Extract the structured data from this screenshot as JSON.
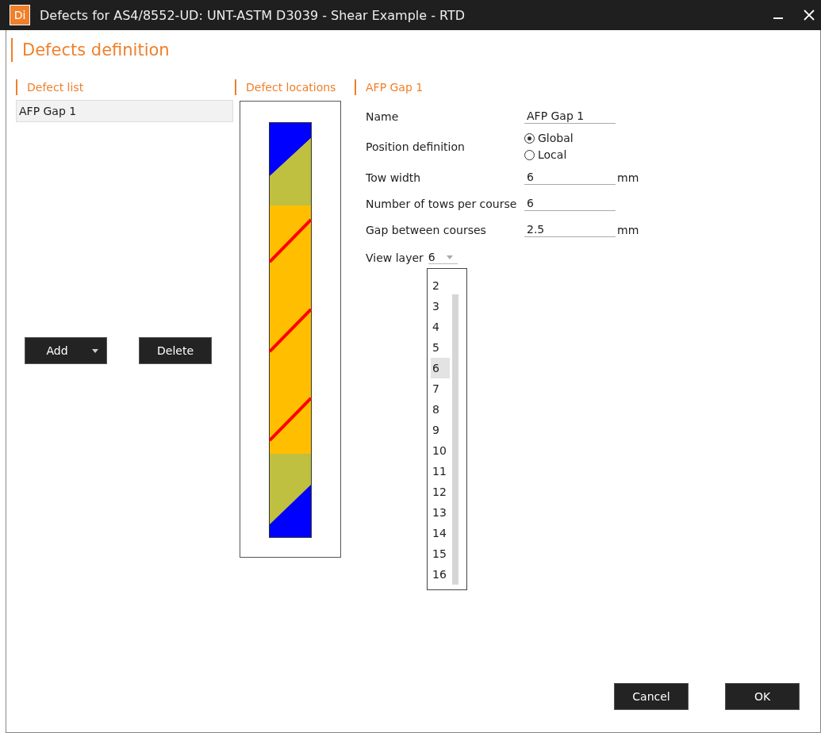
{
  "window": {
    "title": "Defects for AS4/8552-UD: UNT-ASTM D3039 - Shear Example - RTD",
    "app_icon": "Di"
  },
  "page": {
    "title": "Defects definition"
  },
  "defect_list": {
    "heading": "Defect list",
    "items": [
      {
        "label": "AFP Gap 1",
        "selected": true
      }
    ],
    "buttons": [
      {
        "label": "Add",
        "kind": "split"
      },
      {
        "label": "Delete",
        "kind": "plain"
      }
    ]
  },
  "defect_locations": {
    "heading": "Defect locations"
  },
  "properties": {
    "heading": "AFP Gap 1",
    "fields": [
      {
        "kind": "text",
        "label": "Name",
        "value": "AFP Gap 1"
      },
      {
        "kind": "radio",
        "label": "Position definition",
        "options": [
          {
            "label": "Global",
            "selected": true
          },
          {
            "label": "Local",
            "selected": false
          }
        ]
      },
      {
        "kind": "text",
        "label": "Tow width",
        "value": "6",
        "unit": "mm"
      },
      {
        "kind": "text",
        "label": "Number of tows per course",
        "value": "6"
      },
      {
        "kind": "text",
        "label": "Gap between courses",
        "value": "2.5",
        "unit": "mm"
      }
    ],
    "view_layer": {
      "label": "View layer",
      "value": "6",
      "expanded": true,
      "options": [
        {
          "label": "2",
          "selected": false
        },
        {
          "label": "3",
          "selected": false
        },
        {
          "label": "4",
          "selected": false
        },
        {
          "label": "5",
          "selected": false
        },
        {
          "label": "6",
          "selected": true
        },
        {
          "label": "7",
          "selected": false
        },
        {
          "label": "8",
          "selected": false
        },
        {
          "label": "9",
          "selected": false
        },
        {
          "label": "10",
          "selected": false
        },
        {
          "label": "11",
          "selected": false
        },
        {
          "label": "12",
          "selected": false
        },
        {
          "label": "13",
          "selected": false
        },
        {
          "label": "14",
          "selected": false
        },
        {
          "label": "15",
          "selected": false
        },
        {
          "label": "16",
          "selected": false
        }
      ]
    }
  },
  "footer": {
    "buttons": [
      "Cancel",
      "OK"
    ]
  }
}
